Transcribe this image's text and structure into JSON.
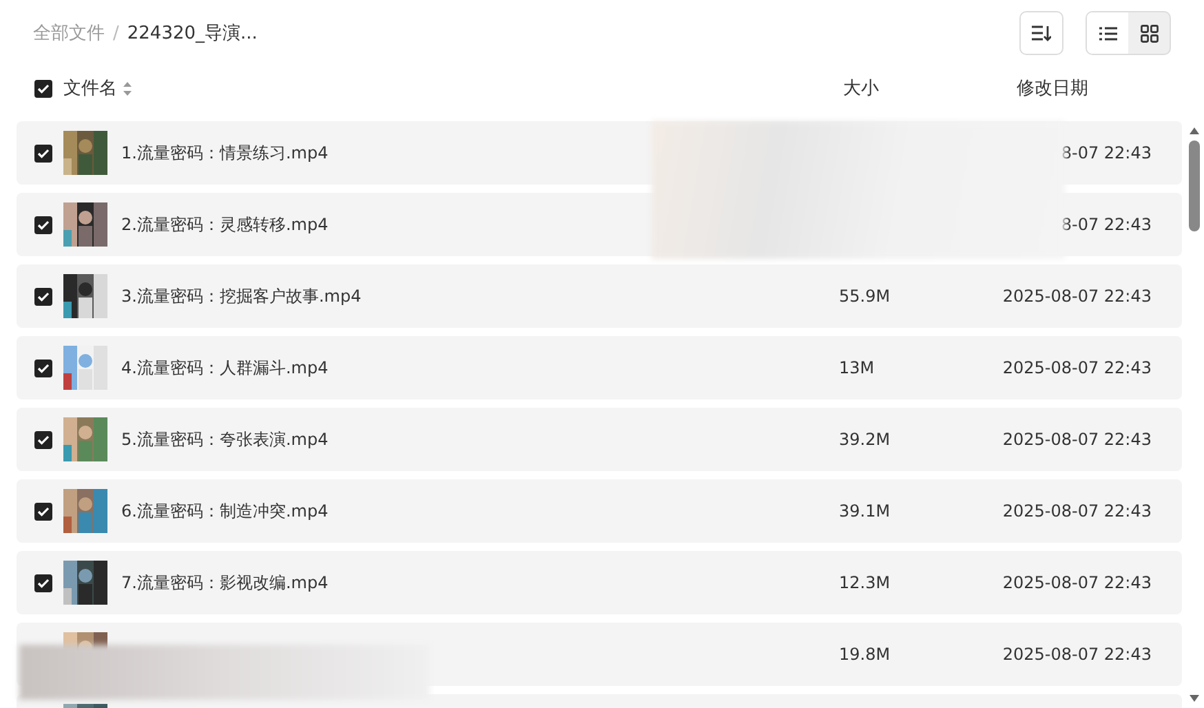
{
  "breadcrumb_separator": "/",
  "breadcrumb": [
    {
      "label": "全部文件",
      "current": false
    },
    {
      "label": "224320_导演...",
      "current": true
    }
  ],
  "toolbar": {
    "view_modes": [
      {
        "kind": "list",
        "selected": true
      },
      {
        "kind": "grid",
        "selected": false
      }
    ]
  },
  "header": {
    "select_all": {
      "checked": true
    },
    "columns": [
      "文件名",
      "大小",
      "修改日期"
    ]
  },
  "rows": [
    {
      "checked": true,
      "thumbnail": {
        "kind": "picture"
      },
      "name": "1.流量密码：情景练习.mp4",
      "modified": "8-07 22:43"
    },
    {
      "checked": true,
      "thumbnail": {
        "kind": "picture"
      },
      "name": "2.流量密码：灵感转移.mp4",
      "modified": "8-07 22:43"
    },
    {
      "checked": true,
      "thumbnail": {
        "kind": "picture"
      },
      "name": "3.流量密码：挖掘客户故事.mp4",
      "size": "55.9M",
      "modified": "2025-08-07 22:43"
    },
    {
      "checked": true,
      "thumbnail": {
        "kind": "picture"
      },
      "name": "4.流量密码：人群漏斗.mp4",
      "size": "13M",
      "modified": "2025-08-07 22:43"
    },
    {
      "checked": true,
      "thumbnail": {
        "kind": "picture"
      },
      "name": "5.流量密码：夸张表演.mp4",
      "size": "39.2M",
      "modified": "2025-08-07 22:43"
    },
    {
      "checked": true,
      "thumbnail": {
        "kind": "picture"
      },
      "name": "6.流量密码：制造冲突.mp4",
      "size": "39.1M",
      "modified": "2025-08-07 22:43"
    },
    {
      "checked": true,
      "thumbnail": {
        "kind": "picture"
      },
      "name": "7.流量密码：影视改编.mp4",
      "size": "12.3M",
      "modified": "2025-08-07 22:43"
    },
    {
      "thumbnail": {
        "kind": "picture"
      },
      "size": "19.8M",
      "modified": "2025-08-07 22:43"
    },
    {
      "thumbnail": {
        "kind": "picture"
      }
    }
  ]
}
